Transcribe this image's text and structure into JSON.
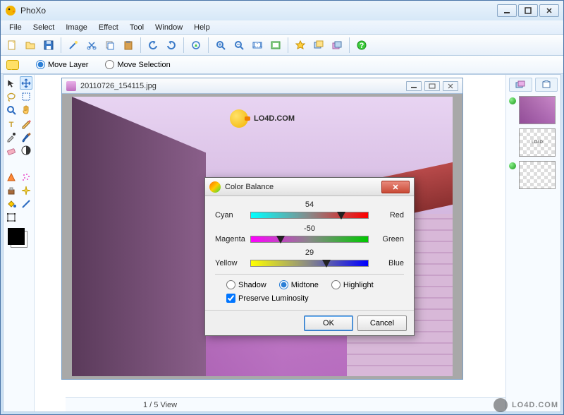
{
  "window": {
    "title": "PhoXo"
  },
  "menu": [
    "File",
    "Select",
    "Image",
    "Effect",
    "Tool",
    "Window",
    "Help"
  ],
  "toolbar_icons": [
    "new-file-icon",
    "open-file-icon",
    "save-icon",
    "sep",
    "wand-icon",
    "cut-icon",
    "copy-icon",
    "paste-icon",
    "sep",
    "undo-icon",
    "redo-icon",
    "sep",
    "crop-icon",
    "sep",
    "zoom-in-icon",
    "zoom-out-icon",
    "zoom-actual-icon",
    "zoom-fit-icon",
    "sep",
    "star-icon",
    "layers-dup-icon",
    "layers-icon",
    "sep",
    "help-icon"
  ],
  "options": {
    "move_layer": "Move Layer",
    "move_selection": "Move Selection",
    "selected": "move_layer"
  },
  "toolbox": [
    [
      "pointer-icon",
      "move-icon"
    ],
    [
      "lasso-icon",
      "marquee-icon"
    ],
    [
      "zoom-icon",
      "hand-icon"
    ],
    [
      "text-icon",
      "pencil-icon"
    ],
    [
      "eyedropper-icon",
      "brush-icon"
    ],
    [
      "eraser-icon",
      "contrast-icon"
    ],
    [
      "",
      ""
    ],
    [
      "shape-icon",
      "spray-icon"
    ],
    [
      "clone-icon",
      "sparkle-icon"
    ],
    [
      "fill-icon",
      "line-icon"
    ],
    [
      "transform-icon",
      ""
    ]
  ],
  "document": {
    "filename": "20110726_154115.jpg"
  },
  "status": {
    "view": "1 / 5 View"
  },
  "watermark": {
    "text": "LO4D.COM"
  },
  "brand_overlay": {
    "text": "LO4D.COM"
  },
  "layer_tabs": [
    "layers-icon",
    "book-icon"
  ],
  "dialog": {
    "title": "Color Balance",
    "sliders": [
      {
        "left": "Cyan",
        "right": "Red",
        "value": 54
      },
      {
        "left": "Magenta",
        "right": "Green",
        "value": -50
      },
      {
        "left": "Yellow",
        "right": "Blue",
        "value": 29
      }
    ],
    "tones": {
      "shadow": "Shadow",
      "midtone": "Midtone",
      "highlight": "Highlight",
      "selected": "midtone"
    },
    "preserve": "Preserve Luminosity",
    "preserve_checked": true,
    "ok": "OK",
    "cancel": "Cancel"
  }
}
